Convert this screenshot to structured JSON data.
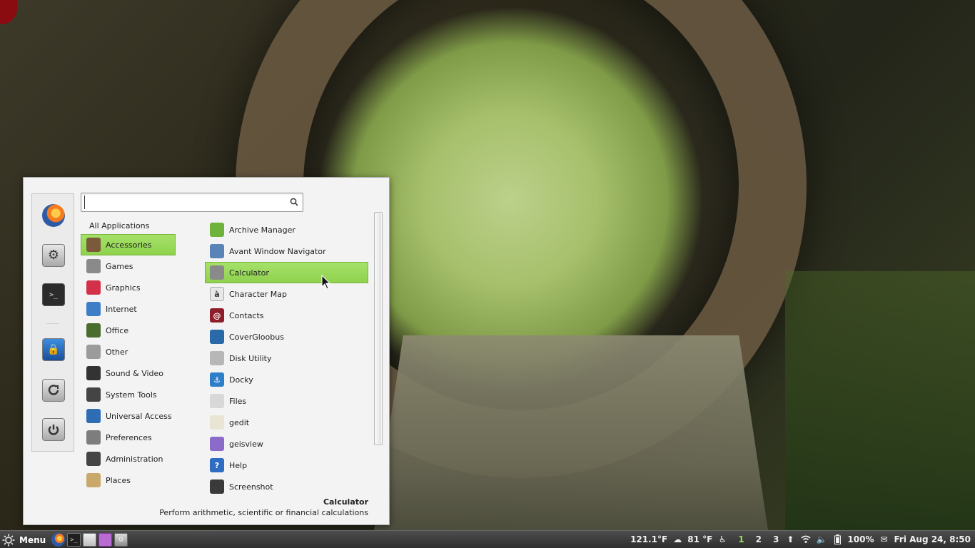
{
  "menu": {
    "search": {
      "value": "",
      "placeholder": ""
    },
    "favorites": [
      {
        "name": "firefox-icon"
      },
      {
        "name": "system-settings-icon"
      },
      {
        "name": "terminal-icon"
      },
      {
        "name": "lock-screen-icon"
      },
      {
        "name": "logout-icon"
      },
      {
        "name": "power-icon"
      }
    ],
    "categories_header": "All Applications",
    "categories": [
      {
        "label": "Accessories",
        "icon": "accessories-icon",
        "color": "#7a5a3a",
        "selected": true
      },
      {
        "label": "Games",
        "icon": "games-icon",
        "color": "#8a8a8a"
      },
      {
        "label": "Graphics",
        "icon": "graphics-icon",
        "color": "#d3304a"
      },
      {
        "label": "Internet",
        "icon": "internet-icon",
        "color": "#3d7fc7"
      },
      {
        "label": "Office",
        "icon": "office-icon",
        "color": "#4b6c2f"
      },
      {
        "label": "Other",
        "icon": "other-icon",
        "color": "#9b9b9b"
      },
      {
        "label": "Sound & Video",
        "icon": "sound-video-icon",
        "color": "#333333"
      },
      {
        "label": "System Tools",
        "icon": "system-tools-icon",
        "color": "#444444"
      },
      {
        "label": "Universal Access",
        "icon": "universal-access-icon",
        "color": "#2e6db4"
      },
      {
        "label": "Preferences",
        "icon": "preferences-icon",
        "color": "#7d7d7d"
      },
      {
        "label": "Administration",
        "icon": "administration-icon",
        "color": "#444444"
      },
      {
        "label": "Places",
        "icon": "folder-icon",
        "color": "#c9a86a"
      }
    ],
    "apps": [
      {
        "label": "Archive Manager",
        "icon": "archive-manager-icon",
        "color": "#6fb23c",
        "glyph": ""
      },
      {
        "label": "Avant Window Navigator",
        "icon": "avant-window-navigator-icon",
        "color": "#5a84b8",
        "glyph": ""
      },
      {
        "label": "Calculator",
        "icon": "calculator-icon",
        "color": "#8a8a8a",
        "glyph": "",
        "selected": true
      },
      {
        "label": "Character Map",
        "icon": "character-map-icon",
        "color": "#e8e8e8",
        "glyph": "à"
      },
      {
        "label": "Contacts",
        "icon": "contacts-icon",
        "color": "#8e1e2a",
        "glyph": "@"
      },
      {
        "label": "CoverGloobus",
        "icon": "covergloobus-icon",
        "color": "#2a6aa8",
        "glyph": ""
      },
      {
        "label": "Disk Utility",
        "icon": "disk-utility-icon",
        "color": "#b7b7b7",
        "glyph": ""
      },
      {
        "label": "Docky",
        "icon": "docky-icon",
        "color": "#2e7fc9",
        "glyph": "⚓"
      },
      {
        "label": "Files",
        "icon": "files-icon",
        "color": "#d8d8d8",
        "glyph": ""
      },
      {
        "label": "gedit",
        "icon": "gedit-icon",
        "color": "#e9e4d3",
        "glyph": ""
      },
      {
        "label": "geisview",
        "icon": "geisview-icon",
        "color": "#8a6bc9",
        "glyph": ""
      },
      {
        "label": "Help",
        "icon": "help-icon",
        "color": "#2f6cc3",
        "glyph": "?"
      },
      {
        "label": "Screenshot",
        "icon": "screenshot-icon",
        "color": "#3a3a3a",
        "glyph": ""
      }
    ],
    "description": {
      "name": "Calculator",
      "text": "Perform arithmetic, scientific or financial calculations"
    }
  },
  "panel": {
    "menu_label": "Menu",
    "launchers": [
      {
        "name": "firefox-launcher"
      },
      {
        "name": "terminal-launcher"
      },
      {
        "name": "files-launcher"
      },
      {
        "name": "pidgin-launcher"
      },
      {
        "name": "settings-launcher"
      }
    ],
    "temperature_cpu": "121.1°F",
    "weather": "81 °F",
    "workspaces": [
      "1",
      "2",
      "3"
    ],
    "active_workspace": "1",
    "battery": "100%",
    "clock": "Fri Aug 24,  8:50"
  },
  "colors": {
    "selection": "#9ad85b",
    "panel": "#3a3a3a",
    "menu_bg": "#f3f3f3"
  }
}
